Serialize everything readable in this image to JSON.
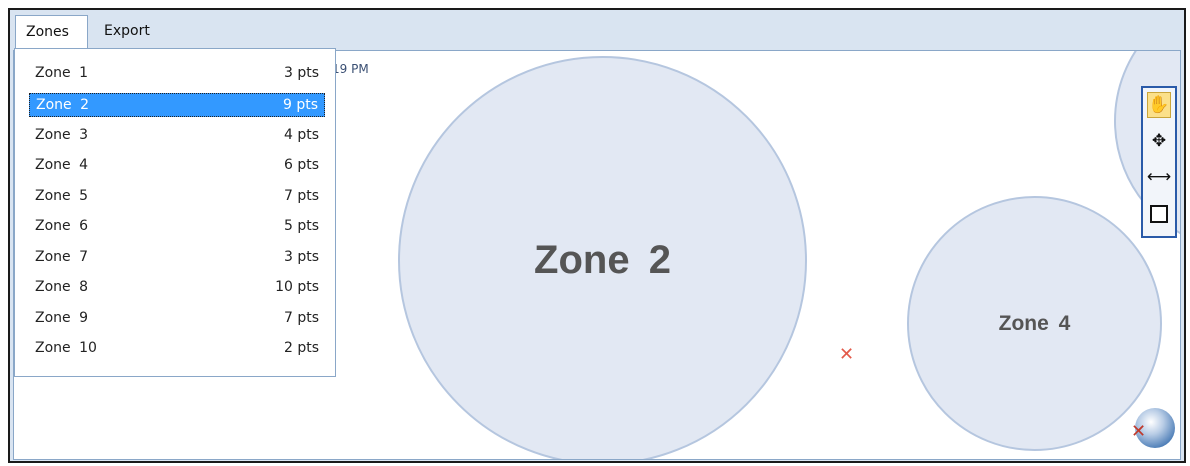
{
  "tabs": [
    {
      "label": "Zones",
      "active": true
    },
    {
      "label": "Export",
      "active": false
    }
  ],
  "map": {
    "timestamp_fragment": ":19 PM",
    "zones": [
      {
        "label": "Zone 2"
      },
      {
        "label": "Zone 4"
      }
    ]
  },
  "toolbar": {
    "tools": [
      {
        "icon": "hand-pan-icon",
        "selected": true
      },
      {
        "icon": "move-icon",
        "selected": false
      },
      {
        "icon": "horizontal-resize-icon",
        "selected": false
      },
      {
        "icon": "fullscreen-icon",
        "selected": false
      }
    ]
  },
  "zone_list": {
    "selected_index": 1,
    "items": [
      {
        "name": "Zone 1",
        "points": "3 pts"
      },
      {
        "name": "Zone 2",
        "points": "9 pts"
      },
      {
        "name": "Zone 3",
        "points": "4 pts"
      },
      {
        "name": "Zone 4",
        "points": "6 pts"
      },
      {
        "name": "Zone 5",
        "points": "7 pts"
      },
      {
        "name": "Zone 6",
        "points": "5 pts"
      },
      {
        "name": "Zone 7",
        "points": "3 pts"
      },
      {
        "name": "Zone 8",
        "points": "10 pts"
      },
      {
        "name": "Zone 9",
        "points": "7 pts"
      },
      {
        "name": "Zone 10",
        "points": "2 pts"
      }
    ]
  },
  "colors": {
    "selection": "#3399ff",
    "zone_fill": "#e2e8f3",
    "zone_border": "#b5c6df",
    "marker": "#e35a4a",
    "tool_selected": "#fbe08a"
  }
}
